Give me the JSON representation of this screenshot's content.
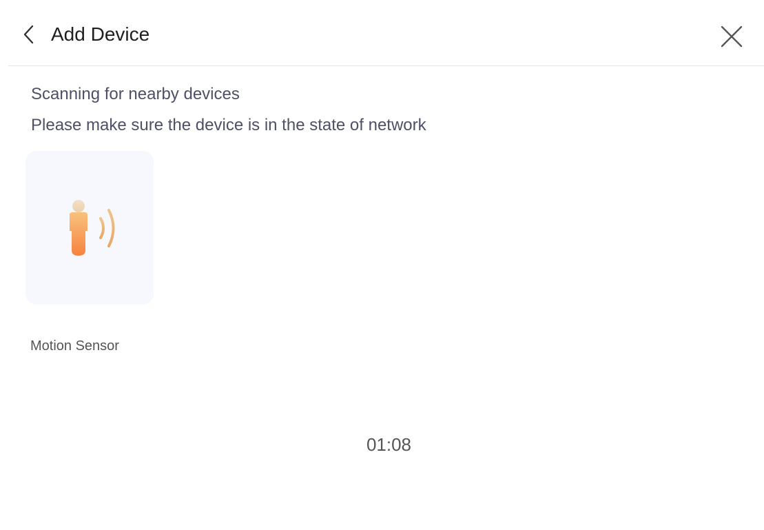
{
  "header": {
    "title": "Add Device",
    "back_icon": "chevron-left-icon",
    "close_icon": "close-icon"
  },
  "scan": {
    "status": "Scanning for nearby devices",
    "hint": "Please make sure the device is in the state of network"
  },
  "devices": [
    {
      "name": "Motion Sensor",
      "icon": "motion-sensor-icon"
    }
  ],
  "countdown": "01:08",
  "colors": {
    "accent_orange": "#f5a04a",
    "card_bg": "#f6f8fd",
    "text_secondary": "#4f4f66"
  }
}
